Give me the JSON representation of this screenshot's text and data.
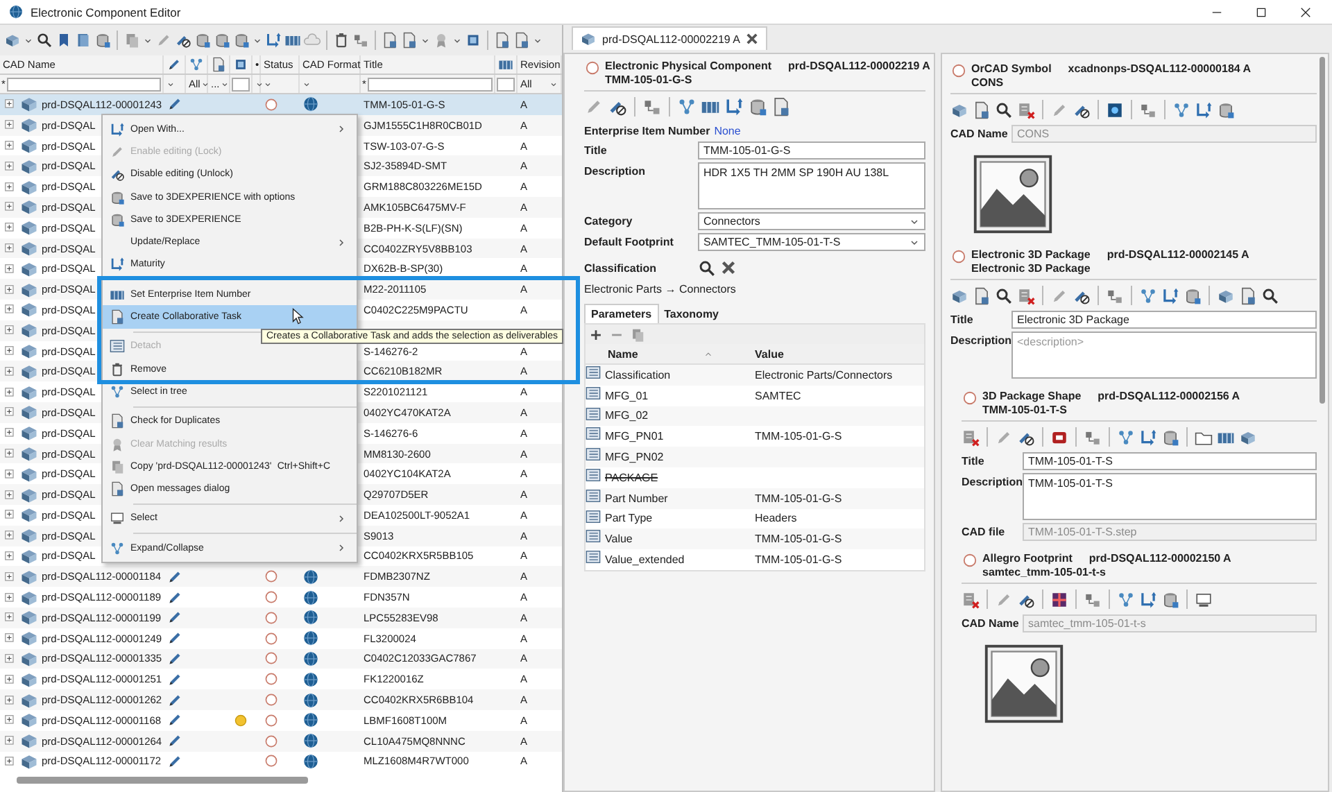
{
  "window": {
    "title": "Electronic Component Editor"
  },
  "left": {
    "columns": [
      {
        "kind": "text",
        "label": "CAD Name"
      },
      {
        "kind": "icon"
      },
      {
        "kind": "icon"
      },
      {
        "kind": "icon"
      },
      {
        "kind": "icon"
      },
      {
        "kind": "text",
        "label": "•"
      },
      {
        "kind": "text",
        "label": "Status"
      },
      {
        "kind": "text",
        "label": "CAD Format"
      },
      {
        "kind": "text",
        "label": "Title"
      },
      {
        "kind": "icon"
      },
      {
        "kind": "text",
        "label": "Revision"
      }
    ],
    "filters": [
      {
        "kind": "text",
        "value": "*"
      },
      {
        "kind": "select"
      },
      {
        "kind": "select",
        "value": "All"
      },
      {
        "kind": "select",
        "value": "..."
      },
      {
        "kind": "blank"
      },
      {
        "kind": "select"
      },
      {
        "kind": "select"
      },
      {
        "kind": "select"
      },
      {
        "kind": "text",
        "value": "*"
      },
      {
        "kind": "blank"
      },
      {
        "kind": "select",
        "value": "All"
      }
    ],
    "rows": [
      {
        "name": "prd-DSQAL112-00001243",
        "title": "TMM-105-01-G-S",
        "revision": "A",
        "marked": false,
        "selected": true
      },
      {
        "name": "prd-DSQAL",
        "title": "GJM1555C1H8R0CB01D",
        "revision": "A",
        "selected": false
      },
      {
        "name": "prd-DSQAL",
        "title": "TSW-103-07-G-S",
        "revision": "A",
        "selected": false
      },
      {
        "name": "prd-DSQAL",
        "title": "SJ2-35894D-SMT",
        "revision": "A",
        "selected": false
      },
      {
        "name": "prd-DSQAL",
        "title": "GRM188C803226ME15D",
        "revision": "A",
        "selected": false
      },
      {
        "name": "prd-DSQAL",
        "title": "AMK105BC6475MV-F",
        "revision": "A",
        "selected": false
      },
      {
        "name": "prd-DSQAL",
        "title": "B2B-PH-K-S(LF)(SN)",
        "revision": "A",
        "selected": false
      },
      {
        "name": "prd-DSQAL",
        "title": "CC0402ZRY5V8BB103",
        "revision": "A",
        "selected": false
      },
      {
        "name": "prd-DSQAL",
        "title": "DX62B-B-SP(30)",
        "revision": "A",
        "selected": false
      },
      {
        "name": "prd-DSQAL",
        "title": "M22-2011105",
        "revision": "A",
        "selected": false
      },
      {
        "name": "prd-DSQAL",
        "title": "C0402C225M9PACTU",
        "revision": "A",
        "selected": false
      },
      {
        "name": "prd-DSQAL",
        "selected": false
      },
      {
        "name": "prd-DSQAL",
        "title": "S-146276-2",
        "revision": "A",
        "selected": false
      },
      {
        "name": "prd-DSQAL",
        "title": "CC6210B182MR",
        "revision": "A",
        "selected": false
      },
      {
        "name": "prd-DSQAL",
        "title": "S2201021121",
        "revision": "A",
        "selected": false
      },
      {
        "name": "prd-DSQAL",
        "title": "0402YC470KAT2A",
        "revision": "A",
        "selected": false
      },
      {
        "name": "prd-DSQAL",
        "title": "S-146276-6",
        "revision": "A",
        "selected": false
      },
      {
        "name": "prd-DSQAL",
        "title": "MM8130-2600",
        "revision": "A",
        "selected": false
      },
      {
        "name": "prd-DSQAL",
        "title": "0402YC104KAT2A",
        "revision": "A",
        "selected": false
      },
      {
        "name": "prd-DSQAL",
        "title": "Q29707D5ER",
        "revision": "A",
        "selected": false
      },
      {
        "name": "prd-DSQAL",
        "title": "DEA102500LT-9052A1",
        "revision": "A",
        "selected": false
      },
      {
        "name": "prd-DSQAL",
        "title": "S9013",
        "revision": "A",
        "selected": false
      },
      {
        "name": "prd-DSQAL",
        "title": "CC0402KRX5R5BB105",
        "revision": "A",
        "selected": false
      },
      {
        "name": "prd-DSQAL112-00001184",
        "title": "FDMB2307NZ",
        "revision": "A",
        "marked": false,
        "selected": false
      },
      {
        "name": "prd-DSQAL112-00001189",
        "title": "FDN357N",
        "revision": "A",
        "marked": false,
        "selected": false
      },
      {
        "name": "prd-DSQAL112-00001199",
        "title": "LPC55283EV98",
        "revision": "A",
        "marked": false,
        "selected": false
      },
      {
        "name": "prd-DSQAL112-00001249",
        "title": "FL3200024",
        "revision": "A",
        "marked": false,
        "selected": false
      },
      {
        "name": "prd-DSQAL112-00001335",
        "title": "C0402C12033GAC7867",
        "revision": "A",
        "marked": false,
        "selected": false
      },
      {
        "name": "prd-DSQAL112-00001251",
        "title": "FK1220016Z",
        "revision": "A",
        "marked": false,
        "selected": false
      },
      {
        "name": "prd-DSQAL112-00001262",
        "title": "CC0402KRX5R6BB104",
        "revision": "A",
        "marked": false,
        "selected": false
      },
      {
        "name": "prd-DSQAL112-00001168",
        "title": "LBMF1608T100M",
        "revision": "A",
        "marked": true,
        "selected": false
      },
      {
        "name": "prd-DSQAL112-00001264",
        "title": "CL10A475MQ8NNNC",
        "revision": "A",
        "marked": false,
        "selected": false
      },
      {
        "name": "prd-DSQAL112-00001172",
        "title": "MLZ1608M4R7WT000",
        "revision": "A",
        "marked": false,
        "selected": false
      }
    ]
  },
  "context_menu": {
    "items": [
      {
        "kind": "item",
        "label": "Open With...",
        "submenu": true,
        "disabled": false,
        "selected": false
      },
      {
        "kind": "item",
        "label": "Enable editing (Lock)",
        "submenu": false,
        "disabled": true,
        "selected": false
      },
      {
        "kind": "item",
        "label": "Disable editing (Unlock)",
        "submenu": false,
        "disabled": false,
        "selected": false
      },
      {
        "kind": "item",
        "label": "Save to 3DEXPERIENCE with options",
        "submenu": false,
        "disabled": false,
        "selected": false
      },
      {
        "kind": "item",
        "label": "Save to 3DEXPERIENCE",
        "submenu": false,
        "disabled": false,
        "selected": false
      },
      {
        "kind": "item",
        "label": "Update/Replace",
        "submenu": true,
        "disabled": false,
        "selected": false
      },
      {
        "kind": "item",
        "label": "Maturity",
        "submenu": false,
        "disabled": false,
        "selected": false
      },
      {
        "kind": "separator"
      },
      {
        "kind": "item",
        "label": "Set Enterprise Item Number",
        "submenu": false,
        "disabled": false,
        "selected": false
      },
      {
        "kind": "item",
        "label": "Create Collaborative Task",
        "submenu": false,
        "disabled": false,
        "selected": true
      },
      {
        "kind": "separator"
      },
      {
        "kind": "item",
        "label": "Detach",
        "submenu": false,
        "disabled": true,
        "selected": false
      },
      {
        "kind": "item",
        "label": "Remove",
        "submenu": false,
        "disabled": false,
        "selected": false
      },
      {
        "kind": "item",
        "label": "Select in tree",
        "submenu": false,
        "disabled": false,
        "selected": false
      },
      {
        "kind": "separator"
      },
      {
        "kind": "item",
        "label": "Check for Duplicates",
        "submenu": false,
        "disabled": false,
        "selected": false
      },
      {
        "kind": "item",
        "label": "Clear Matching results",
        "submenu": false,
        "disabled": true,
        "selected": false
      },
      {
        "kind": "item",
        "label": "Copy 'prd-DSQAL112-00001243'",
        "shortcut": "Ctrl+Shift+C",
        "submenu": false,
        "disabled": false,
        "selected": false
      },
      {
        "kind": "item",
        "label": "Open messages dialog",
        "submenu": false,
        "disabled": false,
        "selected": false
      },
      {
        "kind": "separator"
      },
      {
        "kind": "item",
        "label": "Select",
        "submenu": true,
        "disabled": false,
        "selected": false
      },
      {
        "kind": "separator"
      },
      {
        "kind": "item",
        "label": "Expand/Collapse",
        "submenu": true,
        "disabled": false,
        "selected": false
      }
    ]
  },
  "tooltip": "Creates a Collaborative Task and adds the selection as deliverables",
  "editor": {
    "tab": {
      "label": "prd-DSQAL112-00002219 A",
      "selected": true
    },
    "header": {
      "type": "Electronic Physical Component",
      "id": "prd-DSQAL112-00002219 A",
      "subtitle": "TMM-105-01-G-S"
    },
    "enterprise_item": {
      "label": "Enterprise Item Number",
      "value": "None"
    },
    "fields": [
      {
        "kind": "input",
        "label": "Title",
        "value": "TMM-105-01-G-S"
      },
      {
        "kind": "textarea",
        "label": "Description",
        "value": "HDR 1X5 TH 2MM SP 190H AU 138L"
      },
      {
        "kind": "select",
        "label": "Category",
        "value": "Connectors"
      },
      {
        "kind": "select",
        "label": "Default Footprint",
        "value": "SAMTEC_TMM-105-01-T-S"
      }
    ],
    "classification": {
      "label": "Classification",
      "path": "Electronic Parts → Connectors"
    },
    "tabs": [
      {
        "label": "Parameters",
        "selected": true
      },
      {
        "label": "Taxonomy",
        "selected": false
      }
    ],
    "parameters": {
      "columns": [
        "Name",
        "Value"
      ],
      "rows": [
        {
          "name": "Classification",
          "value": "Electronic Parts/Connectors",
          "deleted": false
        },
        {
          "name": "MFG_01",
          "value": "SAMTEC",
          "deleted": false
        },
        {
          "name": "MFG_02",
          "deleted": false
        },
        {
          "name": "MFG_PN01",
          "value": "TMM-105-01-G-S",
          "deleted": false
        },
        {
          "name": "MFG_PN02",
          "deleted": false
        },
        {
          "name": "PACKAGE",
          "deleted": true
        },
        {
          "name": "Part Number",
          "value": "TMM-105-01-G-S",
          "deleted": false
        },
        {
          "name": "Part Type",
          "value": "Headers",
          "deleted": false
        },
        {
          "name": "Value",
          "value": "TMM-105-01-G-S",
          "deleted": false
        },
        {
          "name": "Value_extended",
          "value": "TMM-105-01-G-S",
          "deleted": false
        }
      ]
    }
  },
  "linked": [
    {
      "type": "OrCAD Symbol",
      "id": "xcadnonps-DSQAL112-00000184 A",
      "subtitle": "CONS",
      "preview": true,
      "fields": [
        {
          "kind": "disabled",
          "label": "CAD Name",
          "value": "CONS"
        }
      ]
    },
    {
      "type": "Electronic 3D Package",
      "id": "prd-DSQAL112-00002145 A",
      "subtitle": "Electronic 3D Package",
      "fields": [
        {
          "kind": "input",
          "label": "Title",
          "value": "Electronic 3D Package"
        },
        {
          "kind": "textarea",
          "label": "Description",
          "placeholder": "<description>"
        }
      ],
      "children": [
        {
          "type": "3D Package Shape",
          "id": "prd-DSQAL112-00002156 A",
          "subtitle": "TMM-105-01-T-S",
          "fields": [
            {
              "kind": "input",
              "label": "Title",
              "value": "TMM-105-01-T-S"
            },
            {
              "kind": "textarea",
              "label": "Description",
              "value": "TMM-105-01-T-S"
            },
            {
              "kind": "disabled",
              "label": "CAD file",
              "value": "TMM-105-01-T-S.step"
            }
          ]
        },
        {
          "type": "Allegro Footprint",
          "id": "prd-DSQAL112-00002150 A",
          "subtitle": "samtec_tmm-105-01-t-s",
          "preview": true,
          "fields": [
            {
              "kind": "disabled",
              "label": "CAD Name",
              "value": "samtec_tmm-105-01-t-s"
            }
          ]
        }
      ]
    }
  ]
}
